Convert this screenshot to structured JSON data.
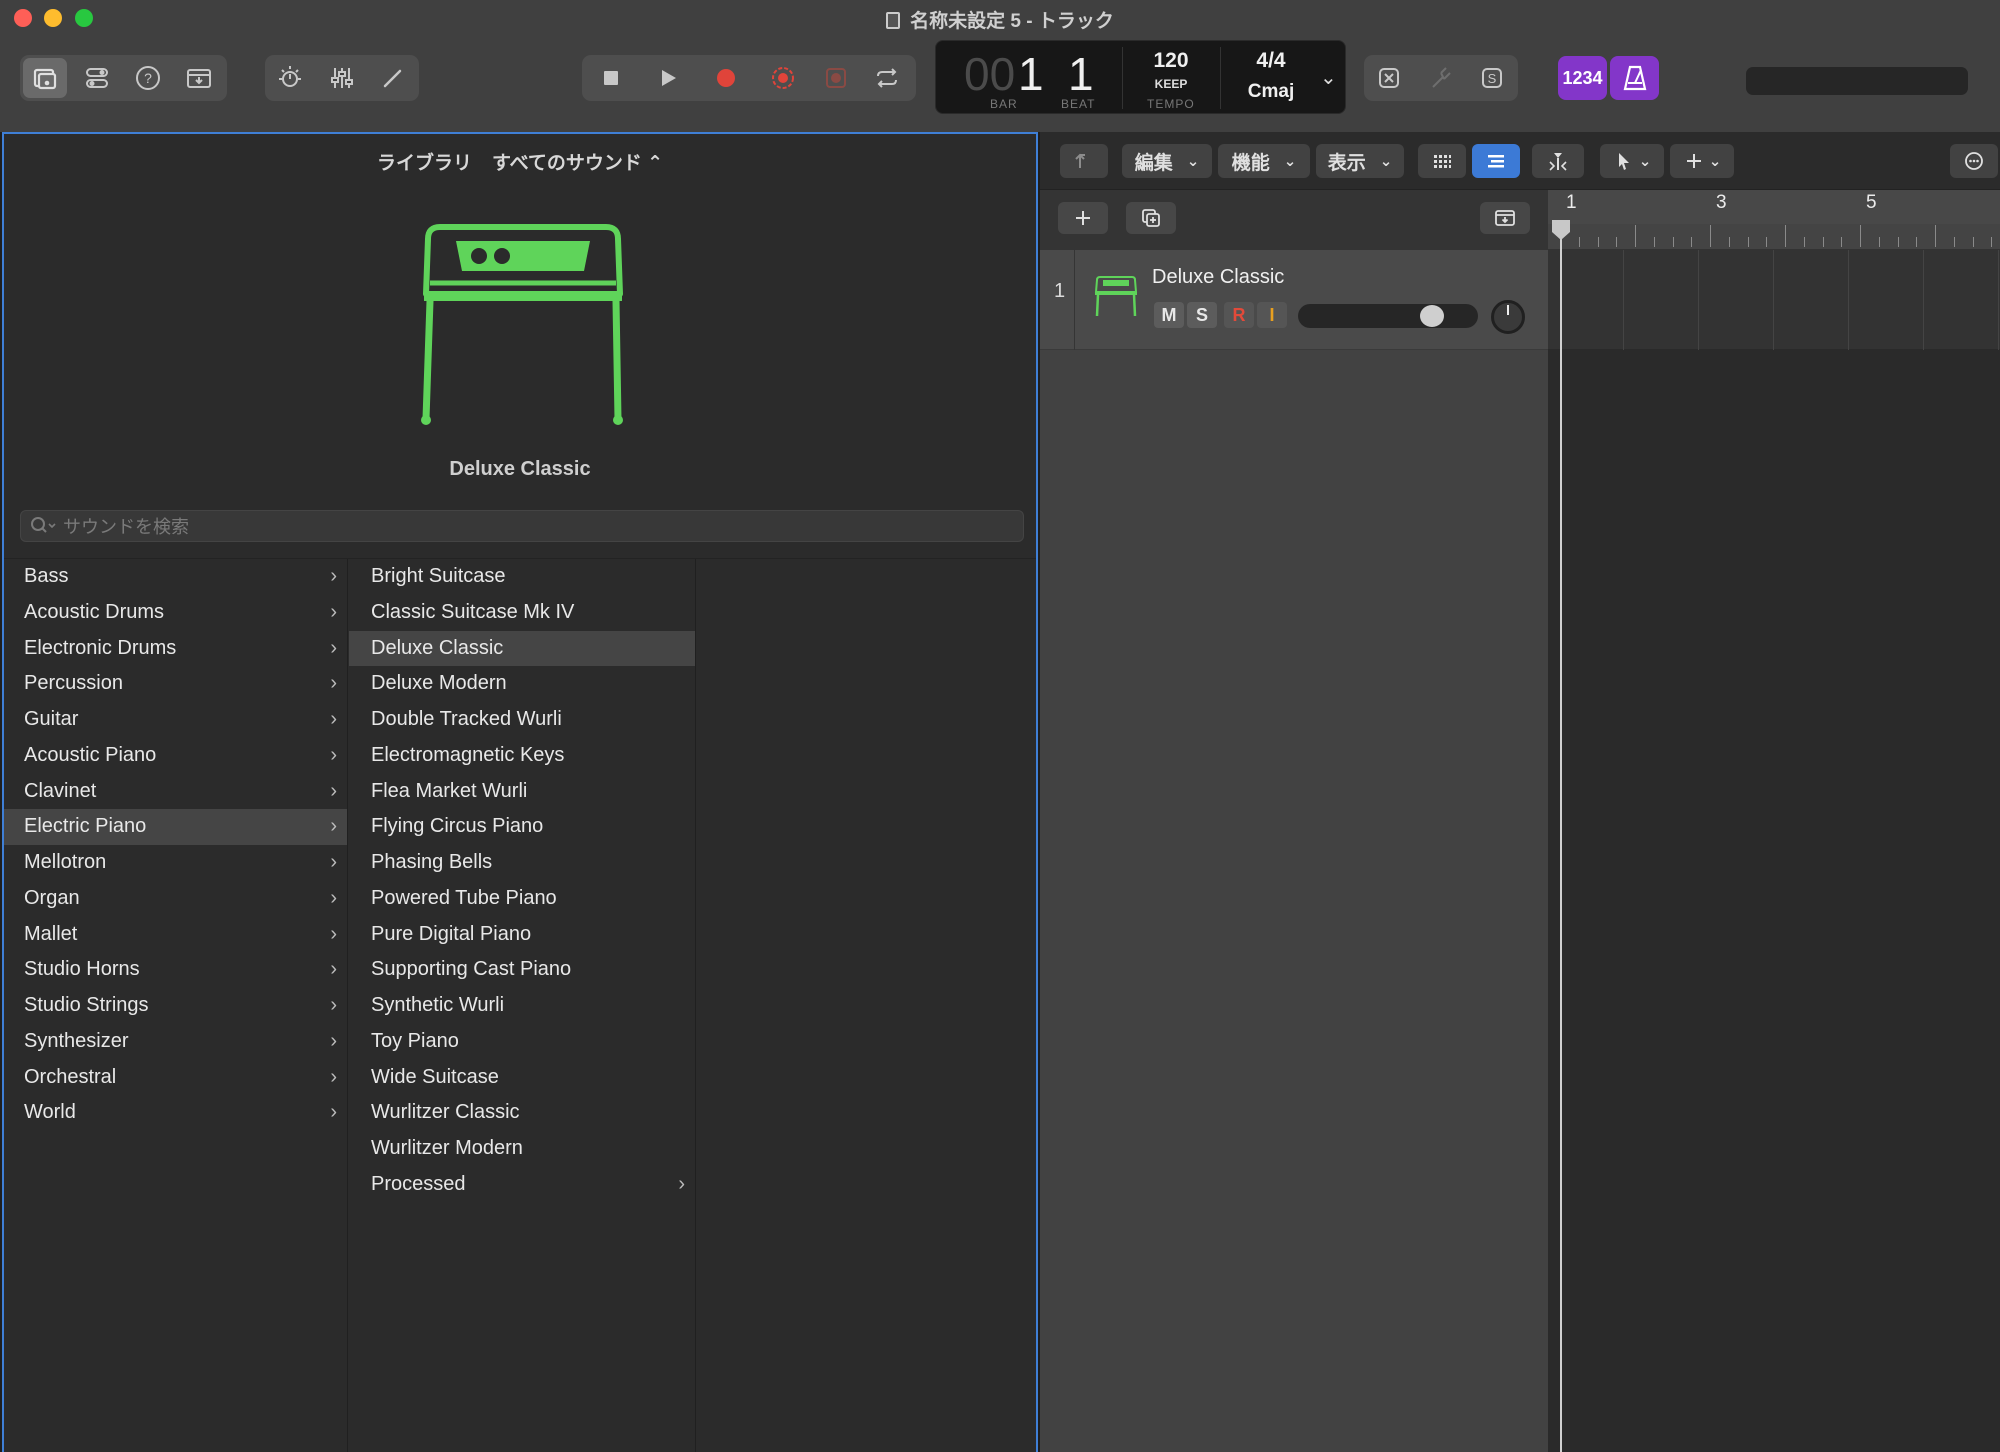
{
  "window": {
    "title": "名称未設定 5 - トラック"
  },
  "lcd": {
    "bar_prefix": "00",
    "bar": "1",
    "beat": "1",
    "bar_caption": "BAR",
    "beat_caption": "BEAT",
    "tempo": "120",
    "tempo_mode": "KEEP",
    "tempo_caption": "TEMPO",
    "time_signature": "4/4",
    "key": "Cmaj"
  },
  "toolbar": {
    "count_in_label": "1234"
  },
  "library": {
    "header_title": "ライブラリ",
    "header_filter": "すべてのサウンド ⌃",
    "selected_patch": "Deluxe Classic",
    "search_placeholder": "サウンドを検索",
    "categories": [
      "Bass",
      "Acoustic Drums",
      "Electronic Drums",
      "Percussion",
      "Guitar",
      "Acoustic Piano",
      "Clavinet",
      "Electric Piano",
      "Mellotron",
      "Organ",
      "Mallet",
      "Studio Horns",
      "Studio Strings",
      "Synthesizer",
      "Orchestral",
      "World"
    ],
    "selected_category": "Electric Piano",
    "patches": [
      "Bright Suitcase",
      "Classic Suitcase Mk IV",
      "Deluxe Classic",
      "Deluxe Modern",
      "Double Tracked Wurli",
      "Electromagnetic Keys",
      "Flea Market Wurli",
      "Flying Circus Piano",
      "Phasing Bells",
      "Powered Tube Piano",
      "Pure Digital Piano",
      "Supporting Cast Piano",
      "Synthetic Wurli",
      "Toy Piano",
      "Wide Suitcase",
      "Wurlitzer Classic",
      "Wurlitzer Modern",
      "Processed"
    ]
  },
  "tracks_toolbar": {
    "edit_menu": "編集",
    "function_menu": "機能",
    "view_menu": "表示"
  },
  "tracks": [
    {
      "number": "1",
      "name": "Deluxe Classic",
      "mute": "M",
      "solo": "S",
      "record": "R",
      "input": "I",
      "volume_level": 0.78
    }
  ],
  "ruler": {
    "markers": [
      "1",
      "3",
      "5"
    ]
  },
  "colors": {
    "accent_blue": "#3c7ad6",
    "instrument_green": "#5fd45a",
    "record_red": "#e0443a",
    "purple": "#8336c9"
  }
}
